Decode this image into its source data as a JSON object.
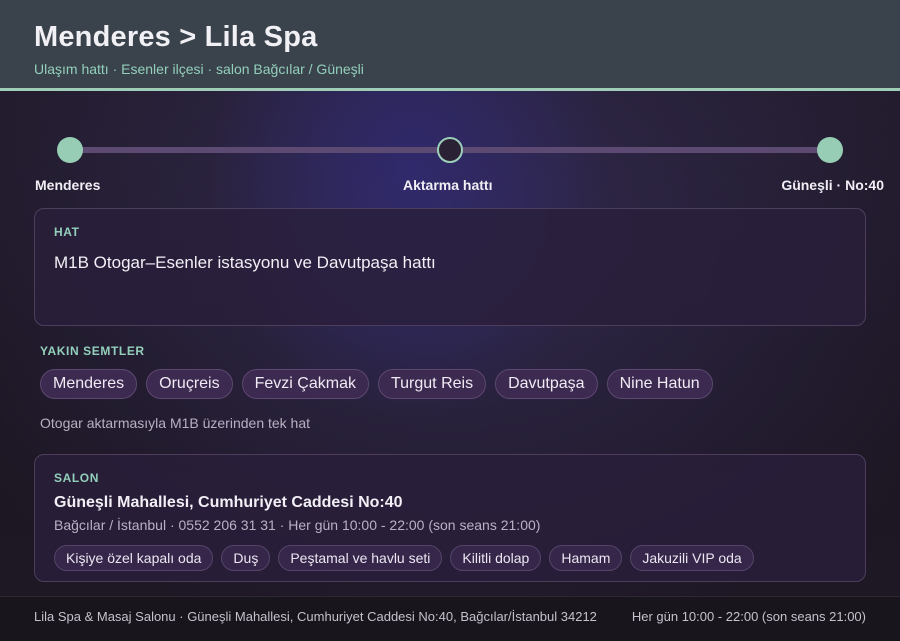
{
  "header": {
    "title": "Menderes > Lila Spa",
    "subtitle": "Ulaşım hattı · Esenler ilçesi · salon Bağcılar / Güneşli"
  },
  "route": {
    "stops": [
      {
        "label": "Menderes"
      },
      {
        "label": "Aktarma hattı"
      },
      {
        "label": "Güneşli · No:40"
      }
    ]
  },
  "line_card": {
    "kicker": "HAT",
    "text": "M1B Otogar–Esenler istasyonu ve Davutpaşa hattı"
  },
  "nearby": {
    "label": "YAKIN SEMTLER",
    "items": [
      "Menderes",
      "Oruçreis",
      "Fevzi Çakmak",
      "Turgut Reis",
      "Davutpaşa",
      "Nine Hatun"
    ],
    "note": "Otogar aktarmasıyla M1B üzerinden tek hat"
  },
  "salon_card": {
    "kicker": "SALON",
    "address": "Güneşli Mahallesi, Cumhuriyet Caddesi No:40",
    "meta": "Bağcılar / İstanbul · 0552 206 31 31 · Her gün 10:00 - 22:00 (son seans 21:00)",
    "amenities": [
      "Kişiye özel kapalı oda",
      "Duş",
      "Peştamal ve havlu seti",
      "Kilitli dolap",
      "Hamam",
      "Jakuzili VIP oda"
    ]
  },
  "footer": {
    "left": "Lila Spa & Masaj Salonu · Güneşli Mahallesi, Cumhuriyet Caddesi No:40, Bağcılar/İstanbul 34212",
    "right": "Her gün 10:00 - 22:00 (son seans 21:00)"
  },
  "colors": {
    "accent": "#93d0bb",
    "header_bg": "#3a424c",
    "chip_bg": "#3d2a50",
    "route_line": "#5d4a73"
  }
}
